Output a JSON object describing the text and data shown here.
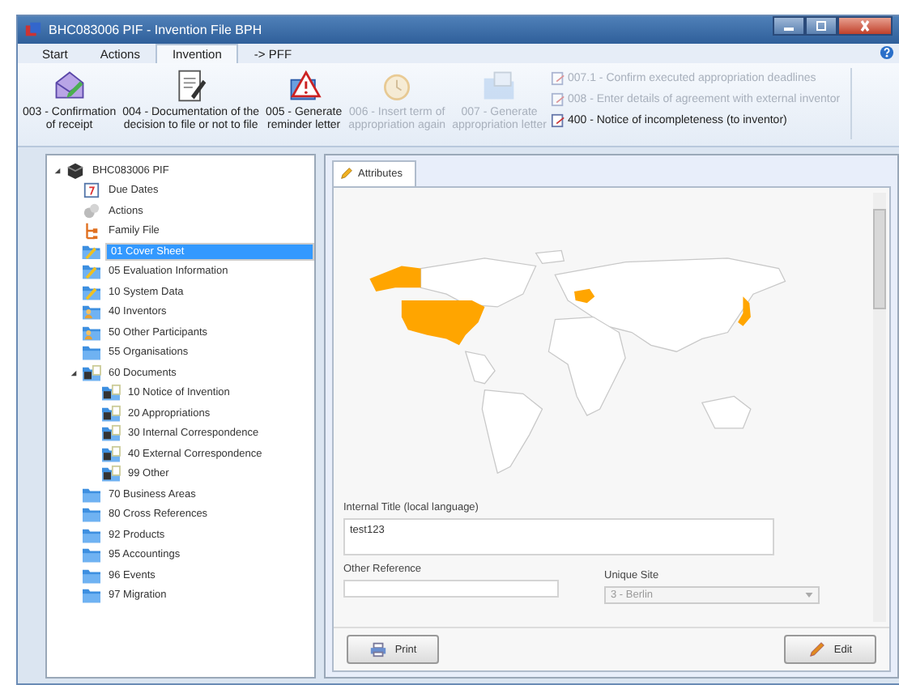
{
  "window": {
    "title": "BHC083006 PIF - Invention File BPH"
  },
  "menu_tabs": [
    {
      "label": "Start",
      "selected": false
    },
    {
      "label": "Actions",
      "selected": false
    },
    {
      "label": "Invention",
      "selected": true
    },
    {
      "label": "-> PFF",
      "selected": false
    }
  ],
  "ribbon": {
    "large_buttons": [
      {
        "label": "003 - Confirmation\nof receipt",
        "kind": "envelope",
        "disabled": false
      },
      {
        "label": "004 - Documentation of the\ndecision to file or not to file",
        "kind": "document",
        "disabled": false
      },
      {
        "label": "005 - Generate\nreminder letter",
        "kind": "warning",
        "disabled": false
      },
      {
        "label": "006 - Insert term of\nappropriation again",
        "kind": "clock",
        "disabled": true
      },
      {
        "label": "007 - Generate\nappropriation letter",
        "kind": "folder",
        "disabled": true
      }
    ],
    "small_buttons": [
      {
        "label": "007.1 - Confirm executed appropriation deadlines",
        "disabled": true
      },
      {
        "label": "008 - Enter details of agreement with external inventor",
        "disabled": true
      },
      {
        "label": "400 - Notice of incompleteness (to inventor)",
        "disabled": false
      }
    ]
  },
  "tree": [
    {
      "label": "BHC083006 PIF",
      "kind": "device",
      "expanded": true,
      "selected": false,
      "children": [
        {
          "label": "Due Dates",
          "kind": "calendar",
          "selected": false
        },
        {
          "label": "Actions",
          "kind": "gears",
          "selected": false
        },
        {
          "label": "Family File",
          "kind": "family",
          "selected": false
        },
        {
          "label": "01 Cover Sheet",
          "kind": "folder-pen",
          "selected": true
        },
        {
          "label": "05 Evaluation Information",
          "kind": "folder-pen",
          "selected": false
        },
        {
          "label": "10 System Data",
          "kind": "folder-pen",
          "selected": false
        },
        {
          "label": "40 Inventors",
          "kind": "folder-person",
          "selected": false
        },
        {
          "label": "50 Other Participants",
          "kind": "folder-person",
          "selected": false
        },
        {
          "label": "55 Organisations",
          "kind": "folder",
          "selected": false
        },
        {
          "label": "60 Documents",
          "kind": "folder-doc",
          "expanded": true,
          "selected": false,
          "children": [
            {
              "label": "10 Notice of Invention",
              "kind": "folder-doc",
              "selected": false
            },
            {
              "label": "20 Appropriations",
              "kind": "folder-doc",
              "selected": false
            },
            {
              "label": "30 Internal Correspondence",
              "kind": "folder-doc",
              "selected": false
            },
            {
              "label": "40 External Correspondence",
              "kind": "folder-doc",
              "selected": false
            },
            {
              "label": "99 Other",
              "kind": "folder-doc",
              "selected": false
            }
          ]
        },
        {
          "label": "70 Business Areas",
          "kind": "folder",
          "selected": false
        },
        {
          "label": "80 Cross References",
          "kind": "folder",
          "selected": false
        },
        {
          "label": "92 Products",
          "kind": "folder",
          "selected": false
        },
        {
          "label": "95 Accountings",
          "kind": "folder",
          "selected": false
        },
        {
          "label": "96 Events",
          "kind": "folder",
          "selected": false
        },
        {
          "label": "97 Migration",
          "kind": "folder",
          "selected": false
        }
      ]
    }
  ],
  "detail": {
    "tabs": [
      {
        "label": "Attributes",
        "selected": true
      }
    ],
    "internal_title": {
      "label": "Internal Title (local language)",
      "value": "test123"
    },
    "other_reference": {
      "label": "Other Reference"
    },
    "unique_site": {
      "label": "Unique Site",
      "value": "3 - Berlin",
      "disabled": true
    },
    "buttons": [
      {
        "label": "Print",
        "kind": "print"
      },
      {
        "label": "Edit",
        "kind": "edit"
      }
    ]
  }
}
